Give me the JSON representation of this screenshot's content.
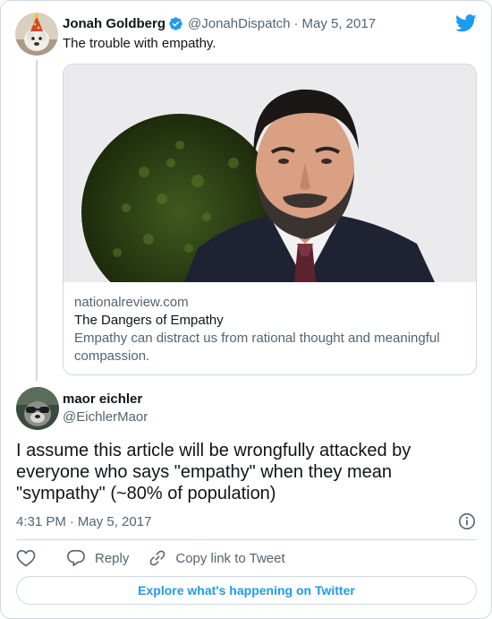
{
  "parent_tweet": {
    "author_name": "Jonah Goldberg",
    "handle": "@JonahDispatch",
    "separator": "·",
    "date": "May 5, 2017",
    "text": "The trouble with empathy.",
    "link_card": {
      "domain": "nationalreview.com",
      "title": "The Dangers of Empathy",
      "description": "Empathy can distract us from rational thought and meaningful compassion."
    }
  },
  "main_tweet": {
    "author_name": "maor eichler",
    "handle": "@EichlerMaor",
    "text": "I assume this article will be wrongfully attacked by everyone who says \"empathy\" when they mean \"sympathy\" (~80% of population)",
    "time": "4:31 PM",
    "separator": "·",
    "date": "May 5, 2017"
  },
  "actions": {
    "reply_label": "Reply",
    "copy_link_label": "Copy link to Tweet"
  },
  "explore_button": {
    "label": "Explore what's happening on Twitter"
  },
  "icons": {
    "logo": "twitter-bird-icon",
    "verified": "verified-badge-icon",
    "info": "info-icon",
    "like": "heart-icon",
    "reply": "speech-bubble-icon",
    "copy": "link-icon"
  },
  "colors": {
    "accent": "#1d9bf0",
    "text_primary": "#0f1419",
    "text_secondary": "#536471",
    "border": "#cfd9de"
  }
}
